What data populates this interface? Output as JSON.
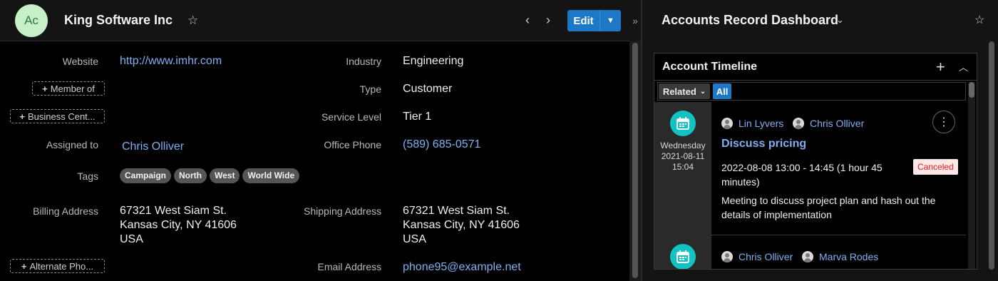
{
  "record": {
    "avatar_initials": "Ac",
    "title": "King Software Inc",
    "edit_label": "Edit"
  },
  "fields": {
    "website_label": "Website",
    "website": "http://www.imhr.com",
    "member_of_button": "Member of",
    "business_center_button": "Business Cent...",
    "assigned_to_label": "Assigned to",
    "assigned_to": "Chris Olliver",
    "tags_label": "Tags",
    "tags": [
      "Campaign",
      "North",
      "West",
      "World Wide"
    ],
    "billing_address_label": "Billing Address",
    "billing_address": [
      "67321 West Siam St.",
      "Kansas City, NY 41606",
      "USA"
    ],
    "alternate_phone_button": "Alternate Pho...",
    "industry_label": "Industry",
    "industry": "Engineering",
    "type_label": "Type",
    "type": "Customer",
    "service_level_label": "Service Level",
    "service_level": "Tier 1",
    "office_phone_label": "Office Phone",
    "office_phone": "(589) 685-0571",
    "shipping_address_label": "Shipping Address",
    "shipping_address": [
      "67321 West Siam St.",
      "Kansas City, NY 41606",
      "USA"
    ],
    "email_label": "Email Address",
    "email": "phone95@example.net"
  },
  "dashboard": {
    "title": "Accounts Record Dashboard",
    "dashlet_title": "Account Timeline",
    "filter_related": "Related",
    "filter_all": "All"
  },
  "timeline": [
    {
      "weekday": "Wednesday",
      "date": "2021-08-11",
      "time": "15:04",
      "users": [
        "Lin Lyvers",
        "Chris Olliver"
      ],
      "title": "Discuss pricing",
      "schedule": "2022-08-08 13:00 - 14:45 (1 hour 45 minutes)",
      "status": "Canceled",
      "description": "Meeting to discuss project plan and hash out the details of implementation"
    },
    {
      "users": [
        "Chris Olliver",
        "Marva Rodes"
      ]
    }
  ],
  "icons": {
    "star": "star-icon",
    "prev": "chevron-left-icon",
    "next": "chevron-right-icon",
    "calendar": "calendar-icon",
    "plus": "plus-icon",
    "more": "more-vertical-icon"
  },
  "colors": {
    "accent": "#1e78c8",
    "link": "#7fb0f0",
    "avatar_bg": "#c7f0c8",
    "timeline_icon": "#12c3c3",
    "canceled_bg": "#fde7e7",
    "canceled_text": "#dd2222"
  }
}
